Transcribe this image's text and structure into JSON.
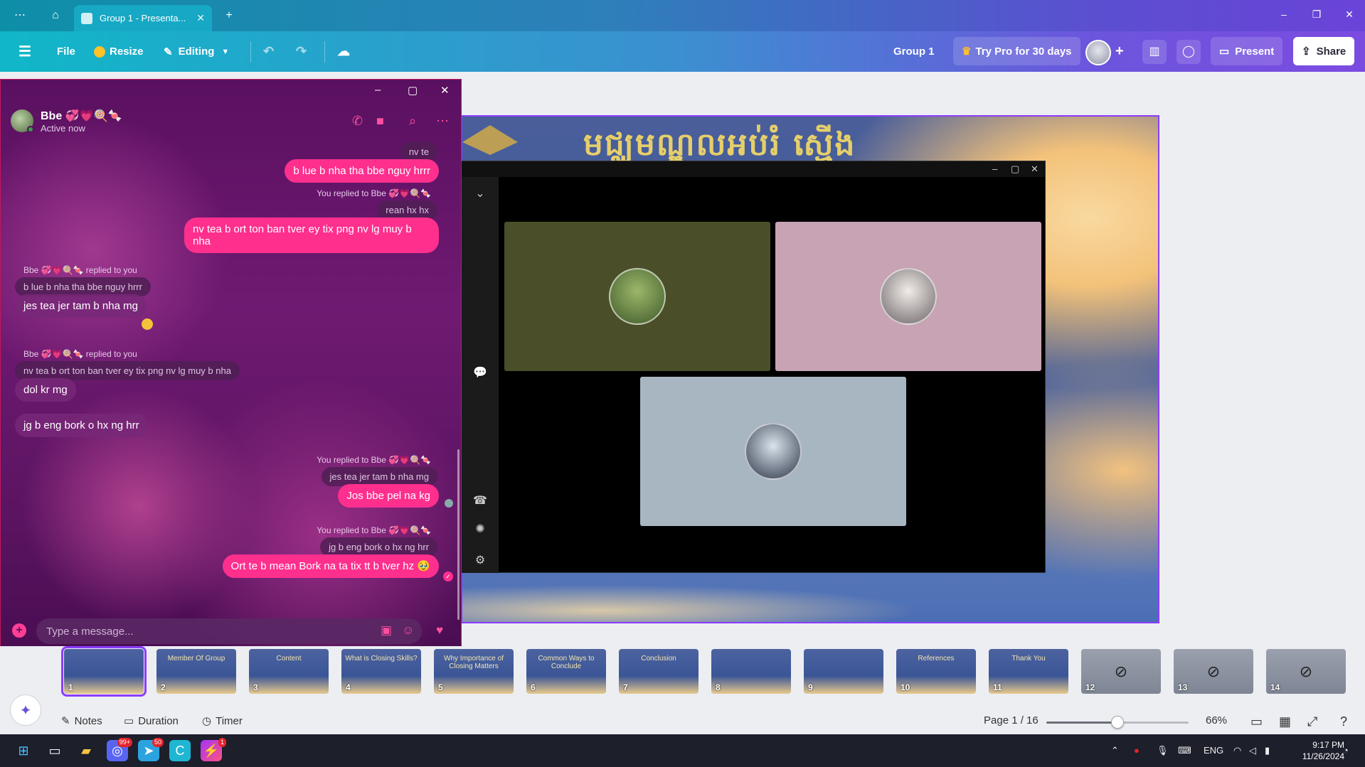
{
  "browser": {
    "tab_title": "Group 1 - Presenta...",
    "new_tab": "+",
    "window_controls": [
      "–",
      "❐",
      "✕"
    ]
  },
  "toolbar": {
    "file": "File",
    "resize": "Resize",
    "editing": "Editing",
    "doc_title": "Group 1",
    "try_pro": "Try Pro for 30 days",
    "present": "Present",
    "share": "Share"
  },
  "slide": {
    "title": "មជ្ឈមណ្ឌលអប់រំ ស្មើង"
  },
  "chat": {
    "name": "Bbe 💞💗🍭🍬",
    "status": "Active now",
    "input_placeholder": "Type a message...",
    "messages": {
      "q1": "nv te",
      "m1": "b lue b nha tha bbe nguy hrrr",
      "r2": "You replied to Bbe 💞💗🍭🍬",
      "q2": "rean hx hx",
      "m2": "nv tea b ort ton ban tver ey tix png nv lg muy b nha",
      "r3": "Bbe 💞💗🍭🍬 replied to you",
      "q3": "b lue b nha tha bbe nguy hrrr",
      "m3": "jes tea jer tam b nha mg",
      "r4": "Bbe 💞💗🍭🍬 replied to you",
      "q4": "nv tea b ort ton ban tver ey tix png nv lg muy b nha",
      "m4": "dol kr mg",
      "m5": "jg b eng bork o hx ng hrr",
      "r6": "You replied to Bbe 💞💗🍭🍬",
      "q6": "jes tea jer tam b nha mg",
      "m6": "Jos bbe pel na kg",
      "r7": "You replied to Bbe 💞💗🍭🍬",
      "q7": "jg b eng bork o hx ng hrr",
      "m7": "Ort te b mean Bork na ta tix tt b tver hz 🥹"
    }
  },
  "pages": {
    "thumbs": [
      {
        "n": "1",
        "label": "",
        "hidden": false
      },
      {
        "n": "2",
        "label": "Member Of Group",
        "hidden": false
      },
      {
        "n": "3",
        "label": "Content",
        "hidden": false
      },
      {
        "n": "4",
        "label": "What is Closing Skills?",
        "hidden": false
      },
      {
        "n": "5",
        "label": "Why Importance of Closing Matters",
        "hidden": false
      },
      {
        "n": "6",
        "label": "Common Ways to Conclude",
        "hidden": false
      },
      {
        "n": "7",
        "label": "Conclusion",
        "hidden": false
      },
      {
        "n": "8",
        "label": "",
        "hidden": false
      },
      {
        "n": "9",
        "label": "",
        "hidden": false
      },
      {
        "n": "10",
        "label": "References",
        "hidden": false
      },
      {
        "n": "11",
        "label": "Thank You",
        "hidden": false
      },
      {
        "n": "12",
        "label": "",
        "hidden": true
      },
      {
        "n": "13",
        "label": "",
        "hidden": true
      },
      {
        "n": "14",
        "label": "",
        "hidden": true
      }
    ]
  },
  "footer": {
    "notes": "Notes",
    "duration": "Duration",
    "timer": "Timer",
    "page_indicator": "Page 1 / 16",
    "zoom": "66%",
    "zoom_fraction": 0.5
  },
  "taskbar": {
    "discord_badge": "99+",
    "telegram_badge": "50",
    "messenger_badge": "1",
    "lang": "ENG",
    "time": "9:17 PM",
    "date": "11/26/2024"
  },
  "colors": {
    "accent": "#8b3dff",
    "messenger_pink": "#ff2f8e"
  }
}
